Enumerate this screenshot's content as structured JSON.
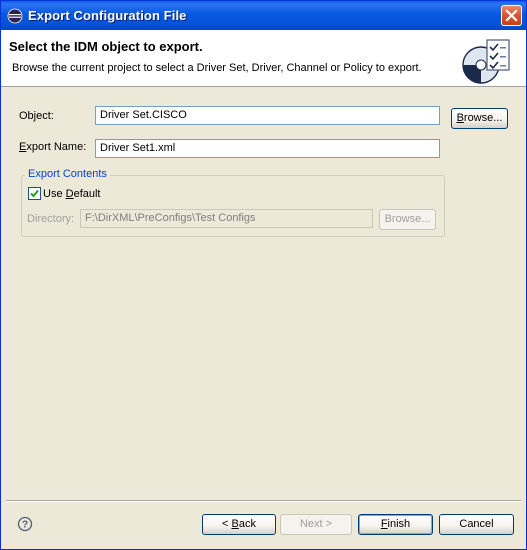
{
  "window": {
    "title": "Export Configuration File"
  },
  "banner": {
    "title": "Select the IDM object to export.",
    "description": "Browse the current project to select a Driver Set, Driver, Channel or Policy to export."
  },
  "form": {
    "object": {
      "label": "Object:",
      "value": "Driver Set.CISCO",
      "browse_label": "Browse..."
    },
    "export_name": {
      "label": "Export Name:",
      "value": "Driver Set1.xml"
    },
    "export_contents": {
      "legend": "Export Contents",
      "use_default": {
        "label": "Use Default",
        "checked": true
      },
      "directory": {
        "label": "Directory:",
        "value": "F:\\DirXML\\PreConfigs\\Test Configs",
        "browse_label": "Browse..."
      }
    }
  },
  "footer": {
    "back_label": "< Back",
    "next_label": "Next >",
    "finish_label": "Finish",
    "cancel_label": "Cancel"
  },
  "icons": {
    "app": "eclipse-icon",
    "close": "close-icon",
    "banner": "export-wizard-icon",
    "help": "help-icon",
    "checkbox": "checkmark-icon"
  }
}
